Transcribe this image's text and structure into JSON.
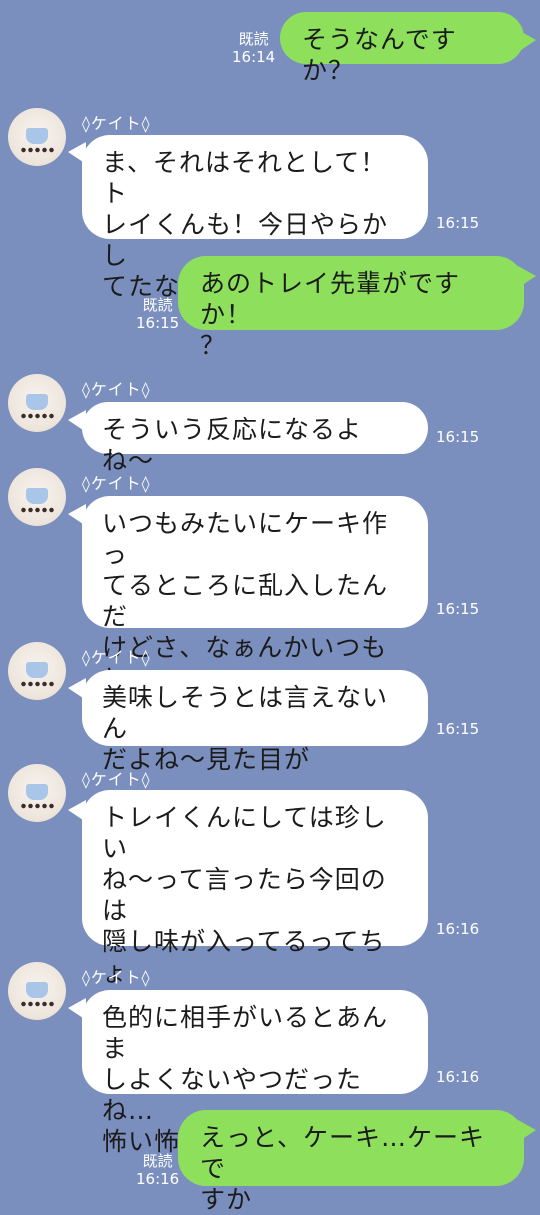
{
  "messages": [
    {
      "dir": "out",
      "text": "そうなんですか？",
      "read": "既読",
      "time": "16:14"
    },
    {
      "dir": "in",
      "sender": "◊ケイト◊",
      "text": "ま、それはそれとして！ト\nレイくんも！今日やらかし\nてたな〜",
      "time": "16:15"
    },
    {
      "dir": "out",
      "text": "あのトレイ先輩がですか！\n？",
      "read": "既読",
      "time": "16:15"
    },
    {
      "dir": "in",
      "sender": "◊ケイト◊",
      "text": "そういう反応になるよね〜",
      "time": "16:15"
    },
    {
      "dir": "in",
      "sender": "◊ケイト◊",
      "text": "いつもみたいにケーキ作っ\nてるところに乱入したんだ\nけどさ、なぁんかいつもと\n違うのよ",
      "time": "16:15"
    },
    {
      "dir": "in",
      "sender": "◊ケイト◊",
      "text": "美味しそうとは言えないん\nだよね〜見た目が",
      "time": "16:15"
    },
    {
      "dir": "in",
      "sender": "◊ケイト◊",
      "text": "トレイくんにしては珍しい\nね〜って言ったら今回のは\n隠し味が入ってるってちょ\nっと悪い顔してたから多分\nあれは魔法薬かな〜",
      "time": "16:16"
    },
    {
      "dir": "in",
      "sender": "◊ケイト◊",
      "text": "色的に相手がいるとあんま\nしよくないやつだったね…\n怖い怖い",
      "time": "16:16"
    },
    {
      "dir": "out",
      "text": "えっと、ケーキ…ケーキで\nすか",
      "read": "既読",
      "time": "16:16"
    }
  ],
  "colors": {
    "background": "#7b8fbe",
    "incoming": "#ffffff",
    "outgoing": "#8ee05c"
  }
}
